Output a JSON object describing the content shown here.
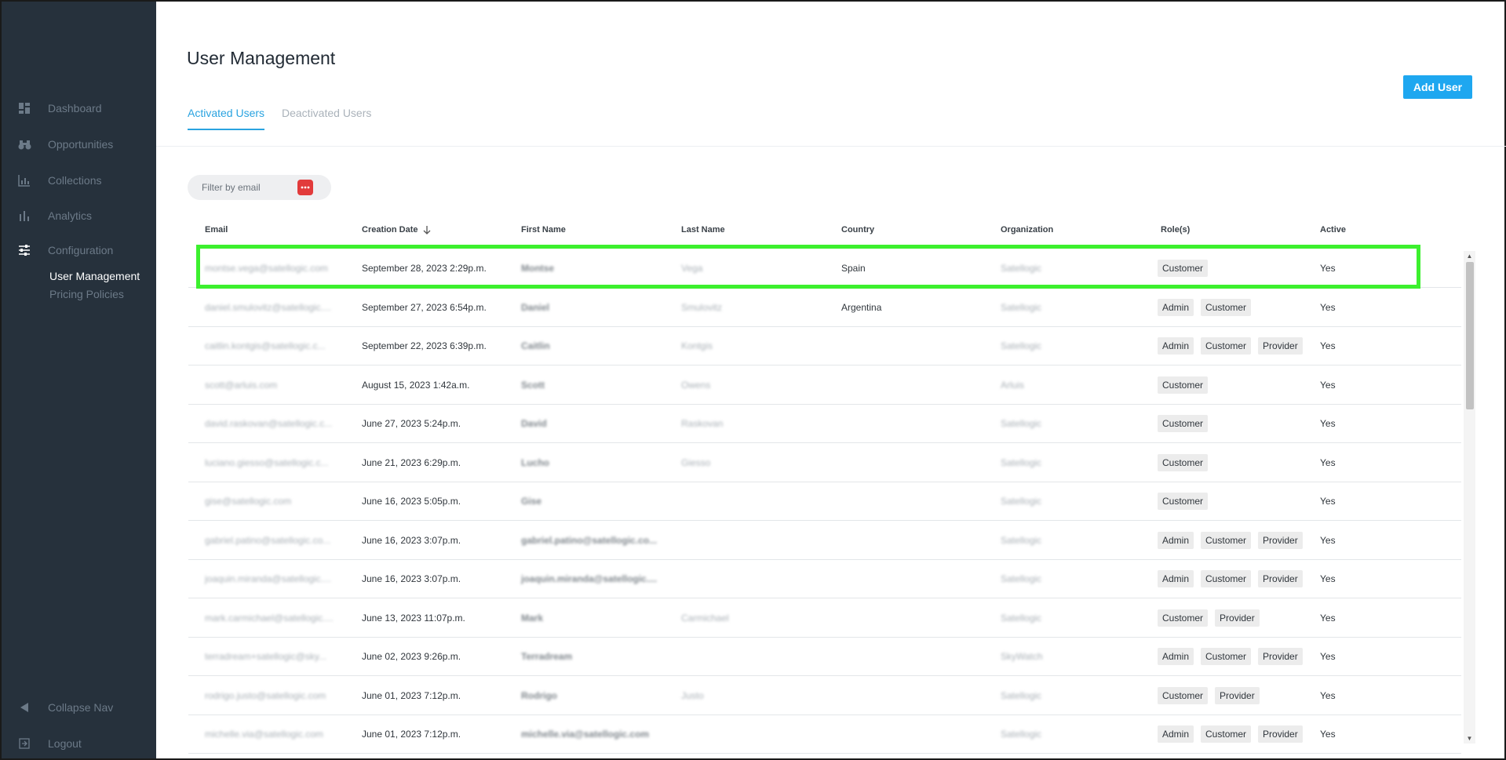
{
  "sidebar": {
    "items": [
      {
        "label": "Dashboard",
        "icon": "dashboard-icon"
      },
      {
        "label": "Opportunities",
        "icon": "binoculars-icon"
      },
      {
        "label": "Collections",
        "icon": "collections-icon"
      },
      {
        "label": "Analytics",
        "icon": "bar-chart-icon"
      },
      {
        "label": "Configuration",
        "icon": "sliders-icon"
      }
    ],
    "sub_items": [
      {
        "label": "User Management"
      },
      {
        "label": "Pricing Policies"
      }
    ],
    "collapse_label": "Collapse Nav",
    "logout_label": "Logout"
  },
  "header": {
    "title": "User Management",
    "tabs": [
      {
        "label": "Activated Users"
      },
      {
        "label": "Deactivated Users"
      }
    ],
    "add_user_label": "Add User"
  },
  "filter": {
    "placeholder": "Filter by email"
  },
  "table": {
    "columns": [
      "Email",
      "Creation Date",
      "First Name",
      "Last Name",
      "Country",
      "Organization",
      "Role(s)",
      "Active"
    ],
    "rows": [
      {
        "email": "montse.vega@satellogic.com",
        "date": "September 28, 2023 2:29p.m.",
        "first": "Montse",
        "last": "Vega",
        "country": "Spain",
        "org": "Satellogic",
        "roles": [
          "Customer"
        ],
        "active": "Yes"
      },
      {
        "email": "daniel.smulovitz@satellogic....",
        "date": "September 27, 2023 6:54p.m.",
        "first": "Daniel",
        "last": "Smulovitz",
        "country": "Argentina",
        "org": "Satellogic",
        "roles": [
          "Admin",
          "Customer"
        ],
        "active": "Yes"
      },
      {
        "email": "caitlin.kontgis@satellogic.c...",
        "date": "September 22, 2023 6:39p.m.",
        "first": "Caitlin",
        "last": "Kontgis",
        "country": "",
        "org": "Satellogic",
        "roles": [
          "Admin",
          "Customer",
          "Provider"
        ],
        "active": "Yes"
      },
      {
        "email": "scott@arluis.com",
        "date": "August 15, 2023 1:42a.m.",
        "first": "Scott",
        "last": "Owens",
        "country": "",
        "org": "Arluis",
        "roles": [
          "Customer"
        ],
        "active": "Yes"
      },
      {
        "email": "david.raskovan@satellogic.c...",
        "date": "June 27, 2023 5:24p.m.",
        "first": "David",
        "last": "Raskovan",
        "country": "",
        "org": "Satellogic",
        "roles": [
          "Customer"
        ],
        "active": "Yes"
      },
      {
        "email": "luciano.giesso@satellogic.c...",
        "date": "June 21, 2023 6:29p.m.",
        "first": "Lucho",
        "last": "Giesso",
        "country": "",
        "org": "Satellogic",
        "roles": [
          "Customer"
        ],
        "active": "Yes"
      },
      {
        "email": "gise@satellogic.com",
        "date": "June 16, 2023 5:05p.m.",
        "first": "Gise",
        "last": "",
        "country": "",
        "org": "Satellogic",
        "roles": [
          "Customer"
        ],
        "active": "Yes"
      },
      {
        "email": "gabriel.patino@satellogic.co...",
        "date": "June 16, 2023 3:07p.m.",
        "first": "gabriel.patino@satellogic.co...",
        "last": "",
        "country": "",
        "org": "Satellogic",
        "roles": [
          "Admin",
          "Customer",
          "Provider"
        ],
        "active": "Yes"
      },
      {
        "email": "joaquin.miranda@satellogic....",
        "date": "June 16, 2023 3:07p.m.",
        "first": "joaquin.miranda@satellogic....",
        "last": "",
        "country": "",
        "org": "Satellogic",
        "roles": [
          "Admin",
          "Customer",
          "Provider"
        ],
        "active": "Yes"
      },
      {
        "email": "mark.carmichael@satellogic....",
        "date": "June 13, 2023 11:07p.m.",
        "first": "Mark",
        "last": "Carmichael",
        "country": "",
        "org": "Satellogic",
        "roles": [
          "Customer",
          "Provider"
        ],
        "active": "Yes"
      },
      {
        "email": "terradream+satellogic@sky...",
        "date": "June 02, 2023 9:26p.m.",
        "first": "Terradream",
        "last": "",
        "country": "",
        "org": "SkyWatch",
        "roles": [
          "Admin",
          "Customer",
          "Provider"
        ],
        "active": "Yes"
      },
      {
        "email": "rodrigo.justo@satellogic.com",
        "date": "June 01, 2023 7:12p.m.",
        "first": "Rodrigo",
        "last": "Justo",
        "country": "",
        "org": "Satellogic",
        "roles": [
          "Customer",
          "Provider"
        ],
        "active": "Yes"
      },
      {
        "email": "michelle.via@satellogic.com",
        "date": "June 01, 2023 7:12p.m.",
        "first": "michelle.via@satellogic.com",
        "last": "",
        "country": "",
        "org": "Satellogic",
        "roles": [
          "Admin",
          "Customer",
          "Provider"
        ],
        "active": "Yes"
      }
    ]
  },
  "colors": {
    "sidebar_bg": "#26313c",
    "accent": "#2aa3e0",
    "add_button": "#1ea7f0",
    "highlight": "#3cf02e",
    "filter_button": "#e23b3b"
  }
}
